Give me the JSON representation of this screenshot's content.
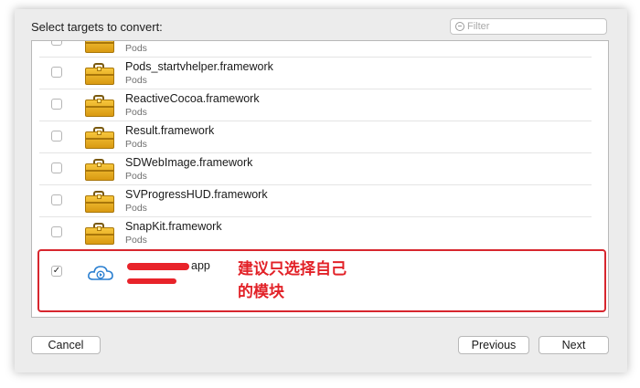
{
  "dialog": {
    "header_label": "Select targets to convert:",
    "filter_placeholder": "Filter"
  },
  "targets": [
    {
      "name": "",
      "sub": "Pods",
      "checked": false,
      "icon": "toolbox-icon"
    },
    {
      "name": "Pods_startvhelper.framework",
      "sub": "Pods",
      "checked": false,
      "icon": "toolbox-icon"
    },
    {
      "name": "ReactiveCocoa.framework",
      "sub": "Pods",
      "checked": false,
      "icon": "toolbox-icon"
    },
    {
      "name": "Result.framework",
      "sub": "Pods",
      "checked": false,
      "icon": "toolbox-icon"
    },
    {
      "name": "SDWebImage.framework",
      "sub": "Pods",
      "checked": false,
      "icon": "toolbox-icon"
    },
    {
      "name": "SVProgressHUD.framework",
      "sub": "Pods",
      "checked": false,
      "icon": "toolbox-icon"
    },
    {
      "name": "SnapKit.framework",
      "sub": "Pods",
      "checked": false,
      "icon": "toolbox-icon"
    }
  ],
  "app_target": {
    "name_visible": "app",
    "checked": true,
    "checkmark": "✓",
    "icon": "cloud-app-icon"
  },
  "annotation": {
    "line1": "建议只选择自己",
    "line2": "的模块",
    "color": "#e22228"
  },
  "buttons": {
    "cancel": "Cancel",
    "previous": "Previous",
    "next": "Next"
  }
}
